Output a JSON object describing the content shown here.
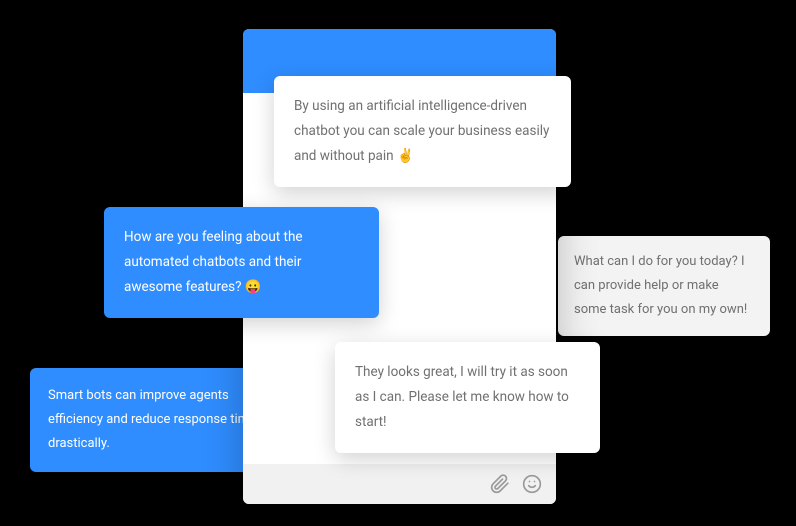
{
  "colors": {
    "accent_blue": "#2f8dff",
    "bubble_gray": "#f3f3f3",
    "text_muted": "#707070"
  },
  "messages": {
    "top_white": "By using an artificial intelligence-driven chatbot you can scale your business easily and without pain ✌️",
    "blue_question": "How are you feeling about the automated chatbots and their awesome features?  😛",
    "right_gray": "What can I do for you today? I can provide help or make some task for you on my own!",
    "bottom_white": "They looks great, I will try it as soon as I can. Please let me know how to start!",
    "left_blue": "Smart bots can improve agents efficiency and reduce response time drastically."
  },
  "icons": {
    "attachment": "attachment",
    "emoji": "emoji"
  }
}
